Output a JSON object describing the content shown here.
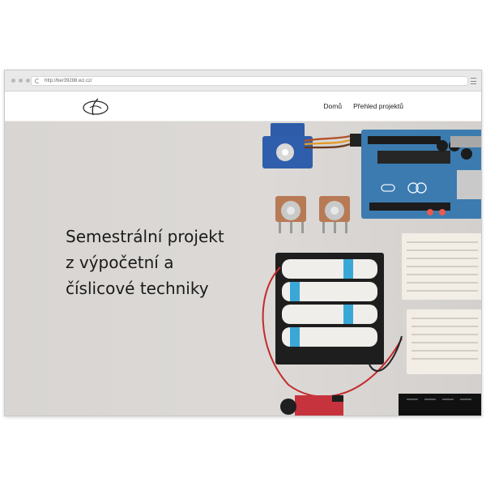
{
  "browser": {
    "url": "http://ber39288.wz.cz/"
  },
  "header": {
    "nav_items": [
      {
        "label": "Domů"
      },
      {
        "label": "Přehled projektů"
      }
    ]
  },
  "hero": {
    "title_lines": [
      "Semestrální projekt",
      "z výpočetní a",
      "číslicové techniky"
    ]
  },
  "colors": {
    "hero_background": "#dad7d4",
    "arduino_board": "#3b7bb0",
    "breadboard": "#f2eee6",
    "servo": "#2e5ca8"
  },
  "icons": {
    "reload": "reload-icon",
    "menu": "hamburger-menu-icon",
    "logo": "site-logo"
  }
}
